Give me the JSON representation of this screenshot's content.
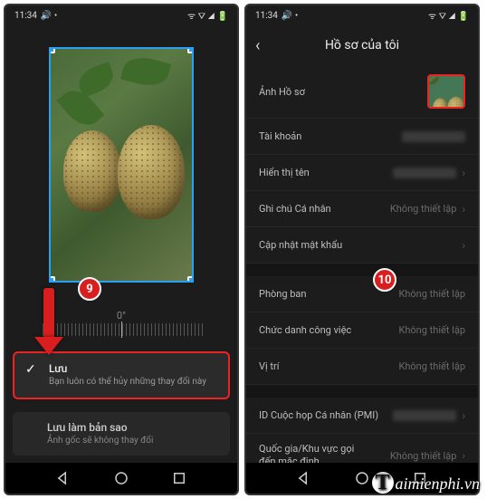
{
  "statusbar": {
    "time": "11:34",
    "icons_left": "🔊 •",
    "icons_right": "ᯤ ⛛ ◢ 🔋"
  },
  "left": {
    "rotation": "0°",
    "save": {
      "title": "Lưu",
      "subtitle": "Bạn luôn có thể hủy những thay đổi này"
    },
    "save_copy": {
      "title": "Lưu làm bản sao",
      "subtitle": "Ảnh gốc sẽ không thay đổi"
    }
  },
  "right": {
    "title": "Hồ sơ của tôi",
    "rows": {
      "photo": "Ảnh Hồ sơ",
      "account": "Tài khoản",
      "display_name": "Hiển thị tên",
      "personal_note": "Ghi chú Cá nhân",
      "update_password": "Cập nhật mật khẩu",
      "department": "Phòng ban",
      "job_title": "Chức danh công việc",
      "location": "Vị trí",
      "pmi": "ID Cuộc họp Cá nhân (PMI)",
      "default_call": "Quốc gia/Khu vực gọi đến mặc định"
    },
    "values": {
      "not_set": "Không thiết lập"
    }
  },
  "annotations": {
    "step9": "9",
    "step10": "10"
  },
  "watermark": {
    "cap": "T",
    "rest": "aimienphi.vn"
  }
}
